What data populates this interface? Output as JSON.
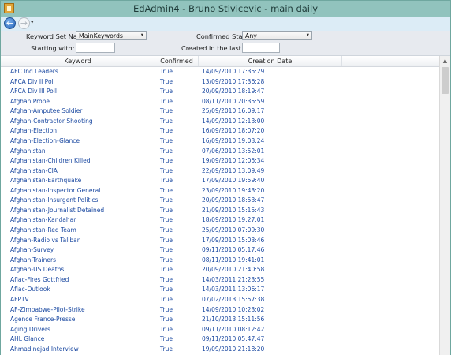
{
  "window": {
    "title": "EdAdmin4 - Bruno Stivicevic - main daily"
  },
  "toolbar": {
    "back_label": "←",
    "forward_label": "→",
    "dropdown_glyph": "▾"
  },
  "filters": {
    "keyword_set_label": "Keyword Set Name:",
    "keyword_set_value": "MainKeywords",
    "confirmed_status_label": "Confirmed Status:",
    "confirmed_status_value": "Any",
    "starting_with_label": "Starting with:",
    "starting_with_value": "",
    "created_last_days_label": "Created in the last days",
    "created_last_days_value": "",
    "combo_arrow": "▾"
  },
  "grid": {
    "columns": [
      "Keyword",
      "Confirmed",
      "Creation Date"
    ],
    "rows": [
      [
        "AFC Ind Leaders",
        "True",
        "14/09/2010 17:35:29"
      ],
      [
        "AFCA Div II Poll",
        "True",
        "13/09/2010 17:36:28"
      ],
      [
        "AFCA Div III Poll",
        "True",
        "20/09/2010 18:19:47"
      ],
      [
        "Afghan Probe",
        "True",
        "08/11/2010 20:35:59"
      ],
      [
        "Afghan-Amputee Soldier",
        "True",
        "25/09/2010 16:09:17"
      ],
      [
        "Afghan-Contractor Shooting",
        "True",
        "14/09/2010 12:13:00"
      ],
      [
        "Afghan-Election",
        "True",
        "16/09/2010 18:07:20"
      ],
      [
        "Afghan-Election-Glance",
        "True",
        "16/09/2010 19:03:24"
      ],
      [
        "Afghanistan",
        "True",
        "07/06/2010 13:52:01"
      ],
      [
        "Afghanistan-Children Killed",
        "True",
        "19/09/2010 12:05:34"
      ],
      [
        "Afghanistan-CIA",
        "True",
        "22/09/2010 13:09:49"
      ],
      [
        "Afghanistan-Earthquake",
        "True",
        "17/09/2010 19:59:40"
      ],
      [
        "Afghanistan-Inspector General",
        "True",
        "23/09/2010 19:43:20"
      ],
      [
        "Afghanistan-Insurgent Politics",
        "True",
        "20/09/2010 18:53:47"
      ],
      [
        "Afghanistan-Journalist Detained",
        "True",
        "21/09/2010 15:15:43"
      ],
      [
        "Afghanistan-Kandahar",
        "True",
        "18/09/2010 19:27:01"
      ],
      [
        "Afghanistan-Red Team",
        "True",
        "25/09/2010 07:09:30"
      ],
      [
        "Afghan-Radio vs Taliban",
        "True",
        "17/09/2010 15:03:46"
      ],
      [
        "Afghan-Survey",
        "True",
        "09/11/2010 05:17:46"
      ],
      [
        "Afghan-Trainers",
        "True",
        "08/11/2010 19:41:01"
      ],
      [
        "Afghan-US Deaths",
        "True",
        "20/09/2010 21:40:58"
      ],
      [
        "Aflac-Fires Gottfried",
        "True",
        "14/03/2011 21:23:55"
      ],
      [
        "Aflac-Outlook",
        "True",
        "14/03/2011 13:06:17"
      ],
      [
        "AFPTV",
        "True",
        "07/02/2013 15:57:38"
      ],
      [
        "AF-Zimbabwe-Pilot-Strike",
        "True",
        "14/09/2010 10:23:02"
      ],
      [
        "Agence France-Presse",
        "True",
        "21/10/2013 15:11:56"
      ],
      [
        "Aging Drivers",
        "True",
        "09/11/2010 08:12:42"
      ],
      [
        "AHL Glance",
        "True",
        "09/11/2010 05:47:47"
      ],
      [
        "Ahmadinejad Interview",
        "True",
        "19/09/2010 21:18:20"
      ]
    ]
  },
  "scrollbar": {
    "up_arrow": "▲"
  }
}
